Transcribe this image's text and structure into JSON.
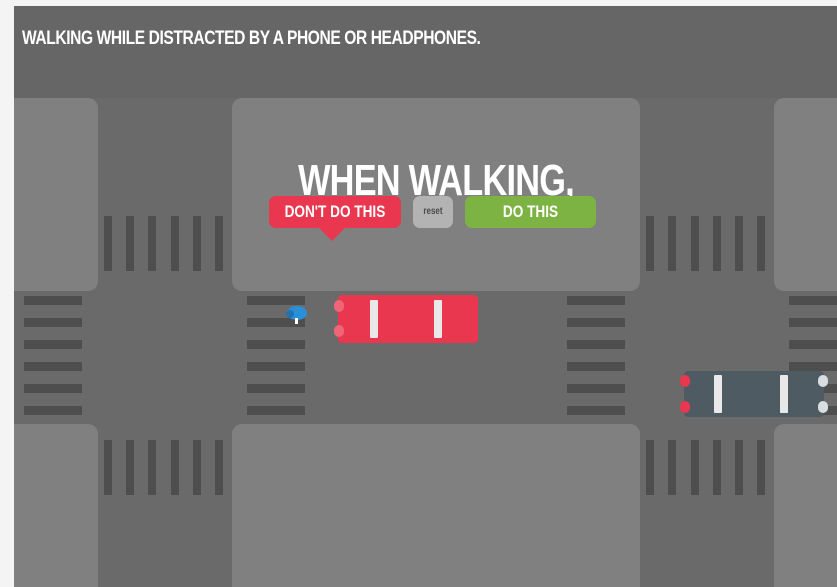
{
  "scenario": {
    "title": "WALKING WHILE DISTRACTED BY A PHONE OR HEADPHONES."
  },
  "panel": {
    "headline": "WHEN WALKING,",
    "buttons": {
      "dont": "DON'T DO THIS",
      "reset": "reset",
      "do": "DO THIS"
    }
  },
  "scene": {
    "cars": [
      {
        "name": "red-car",
        "color": "#e8374e"
      },
      {
        "name": "blue-gray-car",
        "color": "#4f5b63"
      }
    ],
    "pedestrian": {
      "icon": "pedestrian-with-phone-icon",
      "color": "#2a8fd6"
    }
  },
  "colors": {
    "road": "#6a6a6a",
    "block": "#808080",
    "crosswalk": "#4e4e4e",
    "dont_button": "#e8374e",
    "do_button": "#7cb342",
    "reset_button": "#b3b3b3"
  }
}
